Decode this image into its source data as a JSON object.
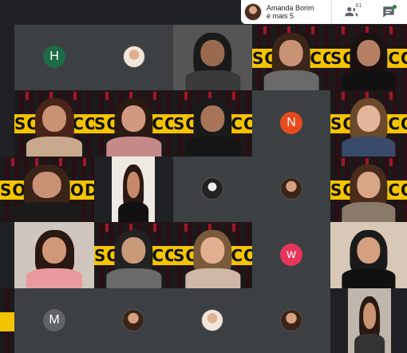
{
  "header": {
    "speaker_name": "Amanda Borim",
    "speaker_more": "e mais 5",
    "participants_count": "61"
  },
  "icons": {
    "participants": "people-icon",
    "chat": "chat-icon"
  },
  "colors": {
    "background": "#202124",
    "tile": "#3c4043",
    "banner_yellow": "#f5c400",
    "banner_red": "#c0172c",
    "avatar_h": "#1e6b47",
    "avatar_n": "#e8491d",
    "avatar_w": "#e8365a",
    "avatar_m": "#5f6368",
    "notification_green": "#1e8e3e"
  },
  "banner_text": "SOUL CODE",
  "avatars": {
    "h_letter": "H",
    "n_letter": "N",
    "w_letter": "w",
    "m_letter": "M"
  }
}
